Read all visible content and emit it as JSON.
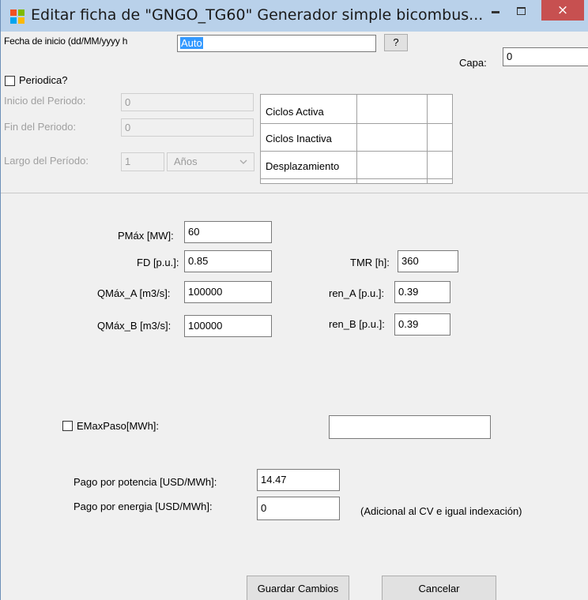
{
  "window": {
    "title": "Editar ficha de  \"GNGO_TG60\" Generador simple bicombus...",
    "close_glyph": "×",
    "icon_colors": [
      "#f25022",
      "#7fba00",
      "#00a4ef",
      "#ffb900"
    ]
  },
  "fecha": {
    "label": "Fecha de inicio (dd/MM/yyyy h",
    "value": "Auto",
    "help_label": "?"
  },
  "capa": {
    "label": "Capa:",
    "value": "0"
  },
  "periodica": {
    "label": "Periodica?",
    "checked": false
  },
  "periodo": {
    "inicio_label": "Inicio del Periodo:",
    "inicio_value": "0",
    "fin_label": "Fin del Periodo:",
    "fin_value": "0",
    "largo_label": "Largo del Período:",
    "largo_value": "1",
    "unidad_value": "Años"
  },
  "ciclos_grid": {
    "rows": [
      "Ciclos Activa",
      "Ciclos Inactiva",
      "Desplazamiento"
    ]
  },
  "params": {
    "pmax_label": "PMáx [MW]:",
    "pmax_value": "60",
    "fd_label": "FD [p.u.]:",
    "fd_value": "0.85",
    "qmax_a_label": "QMáx_A [m3/s]:",
    "qmax_a_value": "100000",
    "qmax_b_label": "QMáx_B [m3/s]:",
    "qmax_b_value": "100000",
    "tmr_label": "TMR [h]:",
    "tmr_value": "360",
    "ren_a_label": "ren_A [p.u.]:",
    "ren_a_value": "0.39",
    "ren_b_label": "ren_B [p.u.]:",
    "ren_b_value": "0.39"
  },
  "emax": {
    "label": "EMaxPaso[MWh]:",
    "checked": false,
    "value": ""
  },
  "pagos": {
    "potencia_label": "Pago por potencia [USD/MWh]:",
    "potencia_value": "14.47",
    "energia_label": "Pago por energia  [USD/MWh]:",
    "energia_value": "0",
    "nota": "(Adicional al CV e igual indexación)"
  },
  "buttons": {
    "guardar": "Guardar Cambios",
    "cancelar": "Cancelar"
  }
}
